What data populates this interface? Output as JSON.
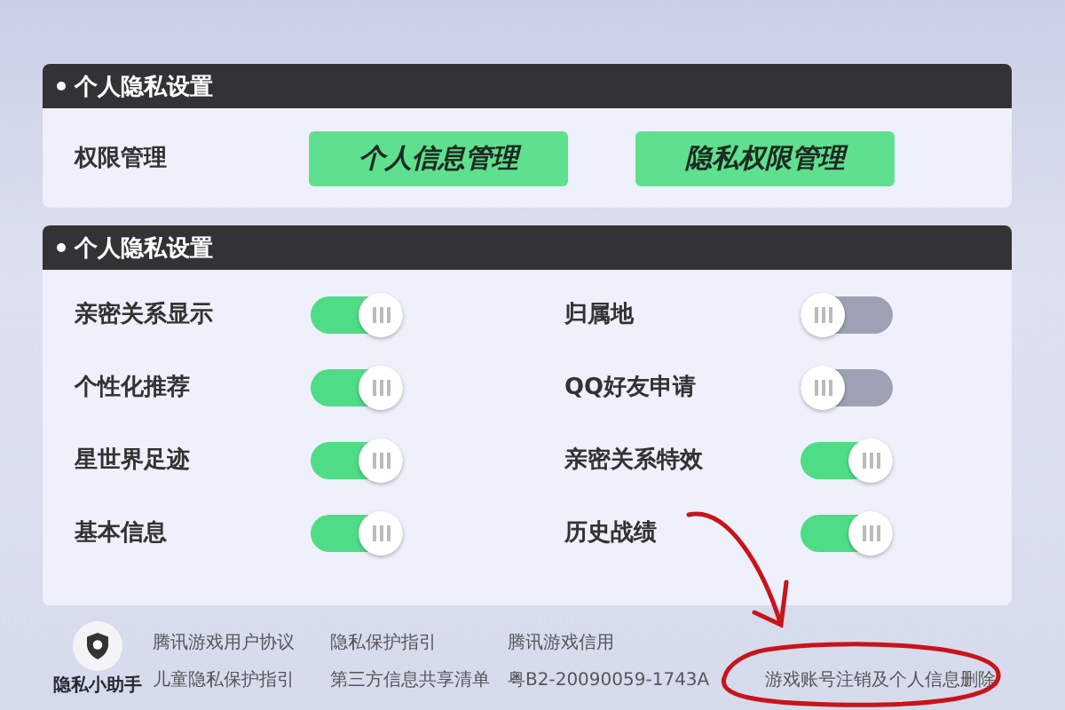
{
  "sections": [
    {
      "title": "个人隐私设置",
      "kind": "buttons",
      "label": "权限管理",
      "buttons": [
        "个人信息管理",
        "隐私权限管理"
      ]
    },
    {
      "title": "个人隐私设置",
      "kind": "toggles",
      "items": [
        {
          "label": "亲密关系显示",
          "on": true
        },
        {
          "label": "归属地",
          "on": false
        },
        {
          "label": "个性化推荐",
          "on": true
        },
        {
          "label": "QQ好友申请",
          "on": false
        },
        {
          "label": "星世界足迹",
          "on": true
        },
        {
          "label": "亲密关系特效",
          "on": true
        },
        {
          "label": "基本信息",
          "on": true
        },
        {
          "label": "历史战绩",
          "on": true
        }
      ]
    }
  ],
  "footer": {
    "assistant": "隐私小助手",
    "links": [
      [
        "腾讯游戏用户协议",
        "儿童隐私保护指引"
      ],
      [
        "隐私保护指引",
        "第三方信息共享清单"
      ],
      [
        "腾讯游戏信用",
        "粤B2-20090059-1743A"
      ],
      [
        "游戏账号注销及个人信息删除"
      ]
    ]
  }
}
